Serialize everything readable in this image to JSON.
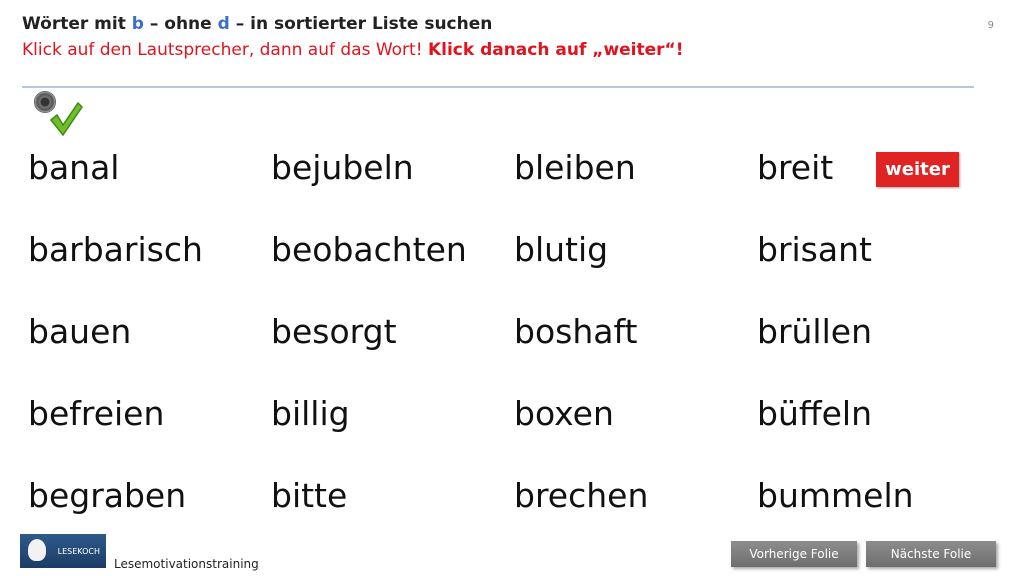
{
  "header": {
    "title_prefix": "Wörter mit ",
    "title_b": "b",
    "title_mid": " – ohne ",
    "title_d": "d",
    "title_suffix": " – in sortierter Liste suchen",
    "instruction": "Klick auf den Lautsprecher, dann auf das Wort! ",
    "instruction_bold": "Klick danach auf „weiter“!",
    "page_number": "9"
  },
  "icons": {
    "speaker": "speaker-icon",
    "check": "checkmark-icon"
  },
  "words": [
    [
      "banal",
      "barbarisch",
      "bauen",
      "befreien",
      "begraben"
    ],
    [
      "bejubeln",
      "beobachten",
      "besorgt",
      "billig",
      "bitte"
    ],
    [
      "bleiben",
      "blutig",
      "boshaft",
      "boxen",
      "brechen"
    ],
    [
      "breit",
      "brisant",
      "brüllen",
      "büffeln",
      "bummeln"
    ]
  ],
  "weiter_label": "weiter",
  "footer": {
    "logo_text": "LESEKOCH",
    "label": "Lesemotivationstraining",
    "prev_label": "Vorherige  Folie",
    "next_label": "Nächste  Folie"
  },
  "colors": {
    "accent_red": "#e0141e",
    "letter_blue": "#3b6fc9",
    "button_red": "#e02424",
    "nav_gray": "#7d7d7d"
  }
}
